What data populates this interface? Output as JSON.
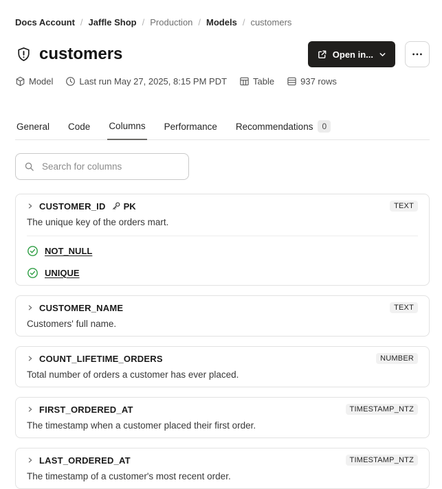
{
  "colors": {
    "constraint_green": "#2f9e44",
    "primary_button_bg": "#201f1d",
    "primary_button_text": "#ffffff",
    "badge_bg": "#f1f1f1",
    "active_tab_underline": "#6b6a66"
  },
  "breadcrumb": {
    "separator": "/",
    "items": [
      {
        "label": "Docs Account",
        "muted": false
      },
      {
        "label": "Jaffle Shop",
        "muted": false
      },
      {
        "label": "Production",
        "muted": true
      },
      {
        "label": "Models",
        "muted": false
      },
      {
        "label": "customers",
        "muted": true
      }
    ]
  },
  "header": {
    "title": "customers",
    "title_icon": "shield-alert-icon",
    "open_in_button": {
      "label": "Open in...",
      "icons": [
        "external-link-icon",
        "chevron-down-icon"
      ]
    },
    "more_button": {
      "icon": "ellipsis-icon"
    }
  },
  "meta": {
    "items": [
      {
        "icon": "cube-icon",
        "label": "Model"
      },
      {
        "icon": "clock-icon",
        "label": "Last run May 27, 2025, 8:15 PM PDT"
      },
      {
        "icon": "table-icon",
        "label": "Table"
      },
      {
        "icon": "rows-icon",
        "label": "937 rows"
      }
    ]
  },
  "tabs": {
    "items": [
      {
        "label": "General",
        "active": false
      },
      {
        "label": "Code",
        "active": false
      },
      {
        "label": "Columns",
        "active": true
      },
      {
        "label": "Performance",
        "active": false
      },
      {
        "label": "Recommendations",
        "active": false,
        "badge": "0"
      }
    ]
  },
  "search": {
    "placeholder": "Search for columns",
    "value": "",
    "icon": "search-icon"
  },
  "columns": [
    {
      "name": "CUSTOMER_ID",
      "pk_label": "PK",
      "type": "TEXT",
      "description": "The unique key of the orders mart.",
      "constraints": [
        "NOT_NULL",
        "UNIQUE"
      ]
    },
    {
      "name": "CUSTOMER_NAME",
      "type": "TEXT",
      "description": "Customers' full name.",
      "constraints": []
    },
    {
      "name": "COUNT_LIFETIME_ORDERS",
      "type": "NUMBER",
      "description": "Total number of orders a customer has ever placed.",
      "constraints": []
    },
    {
      "name": "FIRST_ORDERED_AT",
      "type": "TIMESTAMP_NTZ",
      "description": "The timestamp when a customer placed their first order.",
      "constraints": []
    },
    {
      "name": "LAST_ORDERED_AT",
      "type": "TIMESTAMP_NTZ",
      "description": "The timestamp of a customer's most recent order.",
      "constraints": []
    }
  ]
}
